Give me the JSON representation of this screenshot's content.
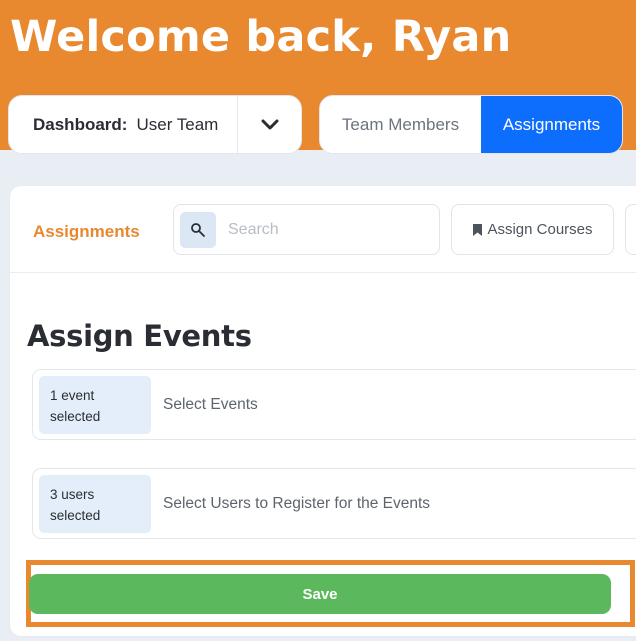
{
  "header": {
    "greeting": "Welcome back, Ryan"
  },
  "dashboard": {
    "label": "Dashboard:",
    "value": "User Team",
    "toggle_icon": "chevron-down-icon"
  },
  "tabs": [
    {
      "label": "Team Members",
      "active": false
    },
    {
      "label": "Assignments",
      "active": true
    }
  ],
  "toolbar": {
    "title": "Assignments",
    "search": {
      "placeholder": "Search",
      "value": "",
      "icon": "search-icon"
    },
    "assign_courses": {
      "label": "Assign Courses",
      "icon": "bookmark-icon"
    }
  },
  "main": {
    "title": "Assign Events",
    "events": {
      "chip_line1": "1 event",
      "chip_line2": "selected",
      "label": "Select Events"
    },
    "users": {
      "chip_line1": "3 users",
      "chip_line2": "selected",
      "label": "Select Users to Register for the Events"
    },
    "save_label": "Save"
  },
  "colors": {
    "header_bg": "#e8892f",
    "accent_orange": "#e8892f",
    "tab_active": "#0d6efd",
    "save_green": "#5cb85c",
    "chip_bg": "#e4eefa"
  }
}
